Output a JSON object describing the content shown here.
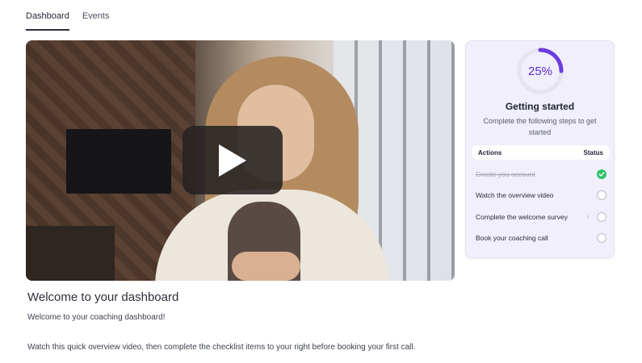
{
  "tabs": [
    {
      "label": "Dashboard",
      "active": true
    },
    {
      "label": "Events",
      "active": false
    }
  ],
  "video": {
    "play_icon": "play-icon",
    "alt": "overview-video"
  },
  "welcome": {
    "title": "Welcome to your dashboard",
    "line1": "Welcome to your coaching dashboard!",
    "line2": "Watch this quick overview video, then complete the checklist items to your right before booking your first call."
  },
  "getting_started": {
    "progress_label": "25%",
    "progress_value": 0.25,
    "title": "Getting started",
    "subtitle": "Complete the following steps to get started",
    "header_actions": "Actions",
    "header_status": "Status",
    "items": [
      {
        "label": "Create you account",
        "done": true
      },
      {
        "label": "Watch the overview video",
        "done": false
      },
      {
        "label": "Complete the welcome survey",
        "done": false,
        "info": "i"
      },
      {
        "label": "Book your coaching call",
        "done": false
      }
    ]
  },
  "colors": {
    "accent": "#6b3be0",
    "success": "#2cc36b",
    "card_bg": "#f0effb"
  }
}
